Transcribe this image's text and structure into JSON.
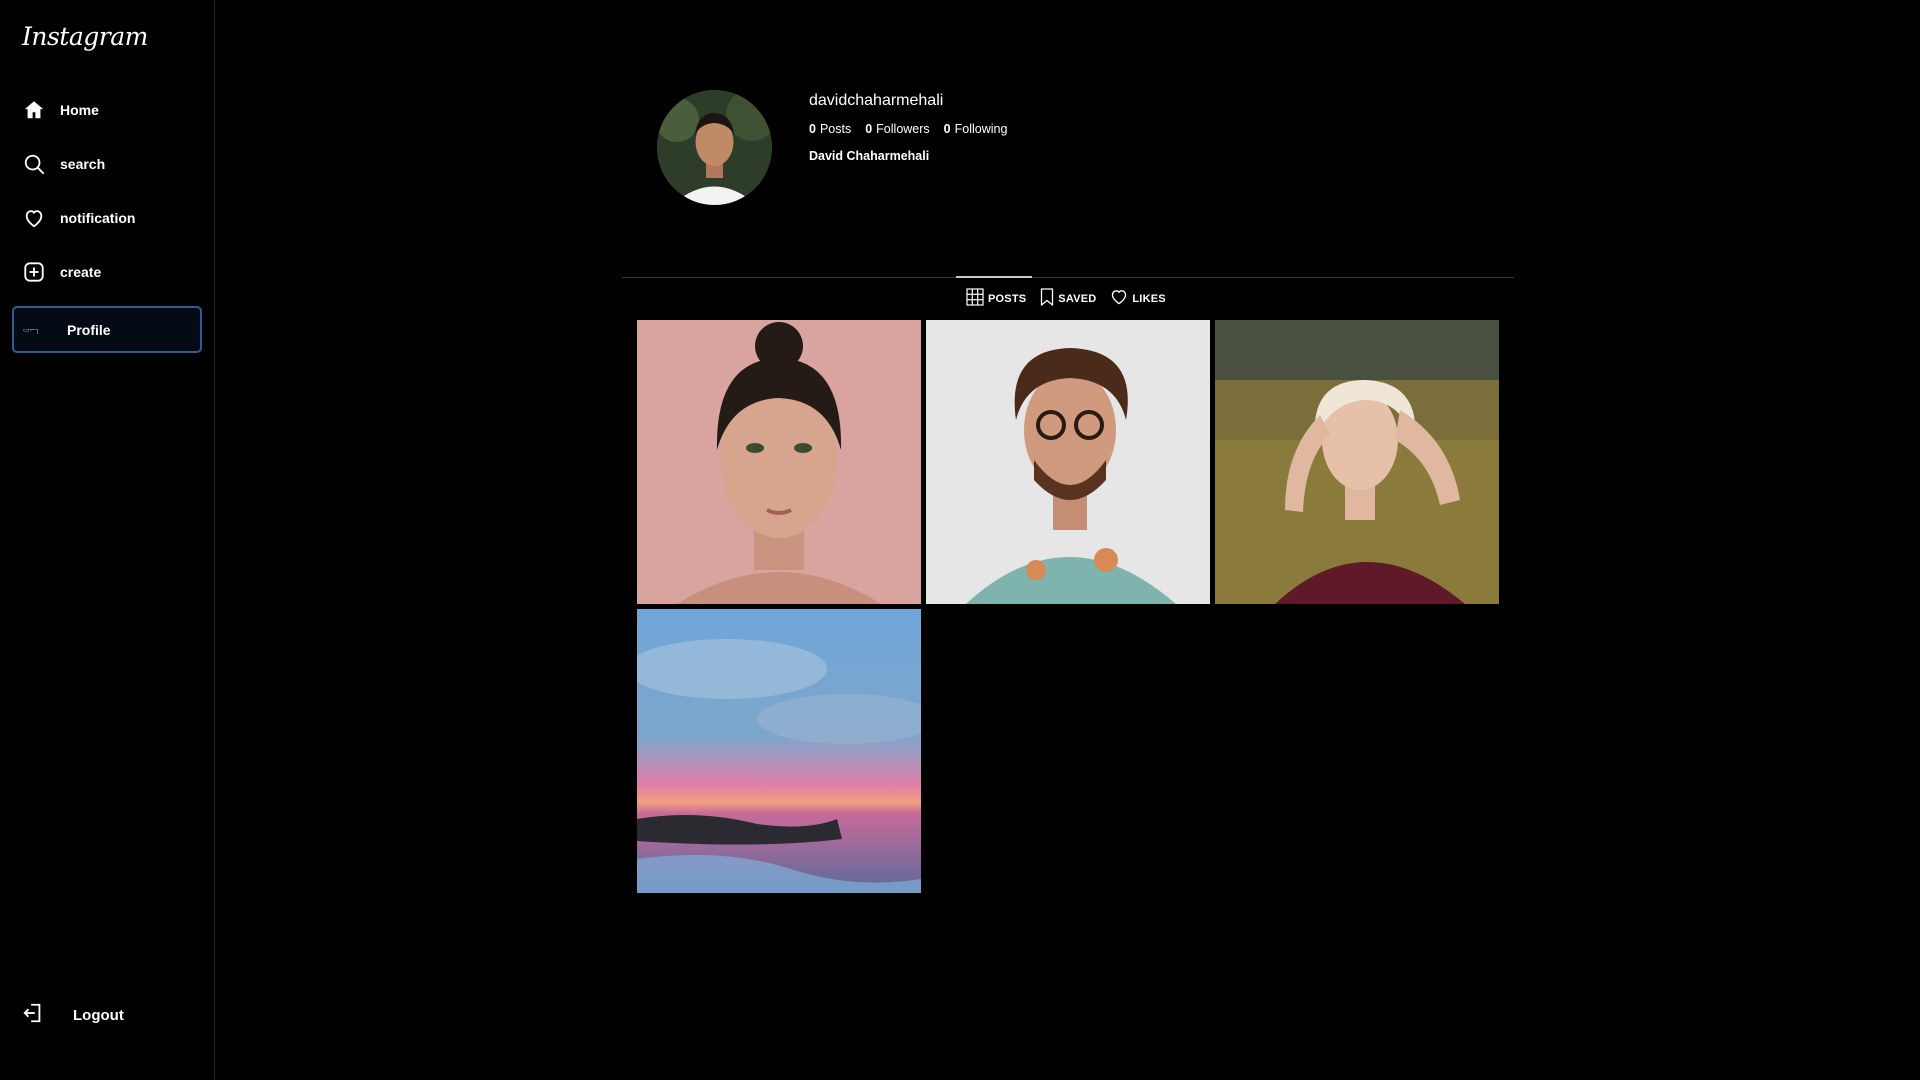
{
  "app": {
    "logo_text": "Instagram"
  },
  "sidebar": {
    "items": [
      {
        "label": "Home",
        "icon": "home-icon"
      },
      {
        "label": "search",
        "icon": "search-icon"
      },
      {
        "label": "notification",
        "icon": "heart-icon"
      },
      {
        "label": "create",
        "icon": "plus-square-icon"
      },
      {
        "label": "Profile",
        "icon": "broken-image-icon",
        "active": true
      }
    ],
    "logout_label": "Logout"
  },
  "profile": {
    "username": "davidchaharmehali",
    "posts_count": "0",
    "posts_label": "Posts",
    "followers_count": "0",
    "followers_label": "Followers",
    "following_count": "0",
    "following_label": "Following",
    "full_name": "David Chaharmehali"
  },
  "tabs": [
    {
      "label": "POSTS",
      "icon": "grid-icon",
      "active": true
    },
    {
      "label": "SAVED",
      "icon": "bookmark-icon"
    },
    {
      "label": "LIKES",
      "icon": "heart-icon"
    }
  ],
  "posts": [
    {
      "subject": "portrait-woman-pink-background"
    },
    {
      "subject": "portrait-man-curly-hair-glasses"
    },
    {
      "subject": "portrait-blonde-woman-field"
    },
    {
      "subject": "sunset-sea-landscape"
    }
  ],
  "colors": {
    "background": "#000000",
    "active_border": "#2f5d93",
    "divider": "#363636"
  }
}
